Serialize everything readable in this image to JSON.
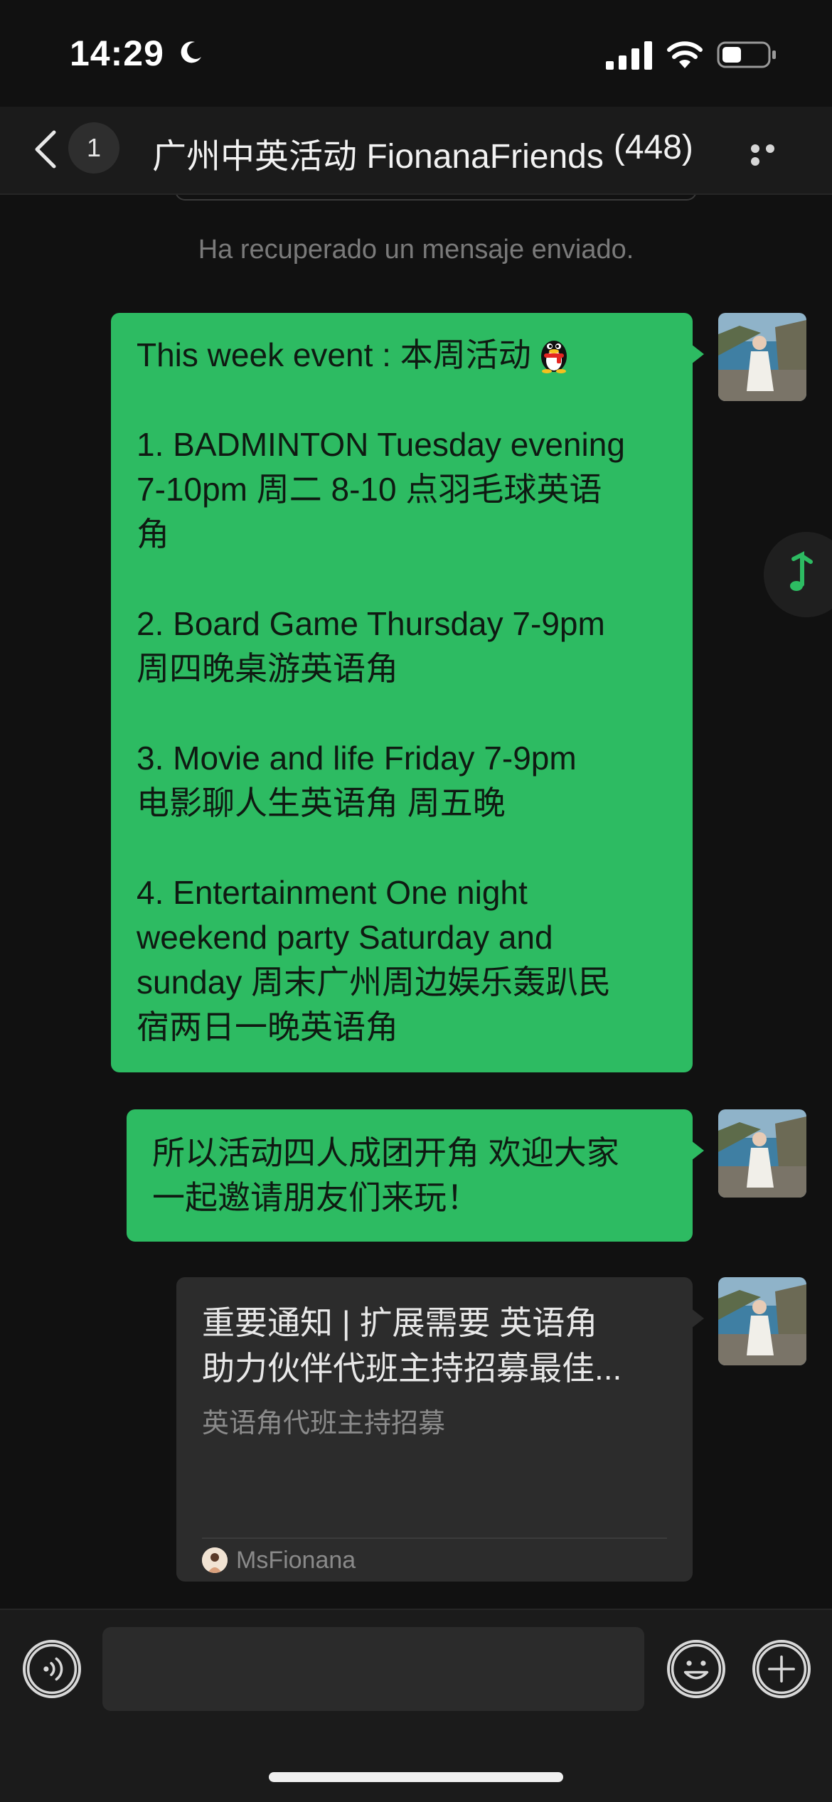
{
  "status_bar": {
    "time": "14:29"
  },
  "nav": {
    "unread_badge": "1",
    "title": "广州中英活动 FionanaFriends",
    "member_count": "(448)"
  },
  "system_message": "Ha recuperado un mensaje enviado.",
  "messages": [
    {
      "lines": [
        "This week event : 本周活动",
        "",
        "1. BADMINTON Tuesday evening",
        "7-10pm 周二 8-10 点羽毛球英语",
        "角",
        "",
        "2. Board Game Thursday 7-9pm",
        "周四晚桌游英语角",
        "",
        "3. Movie and life  Friday 7-9pm",
        "电影聊人生英语角 周五晚",
        "",
        "4. Entertainment One night",
        "weekend party Saturday and",
        "sunday  周末广州周边娱乐轰趴民",
        "宿两日一晚英语角"
      ]
    },
    {
      "lines": [
        "所以活动四人成团开角 欢迎大家",
        "一起邀请朋友们来玩！"
      ]
    }
  ],
  "card": {
    "title_line1": "重要通知 | 扩展需要 英语角",
    "title_line2": "助力伙伴代班主持招募最佳...",
    "description": "英语角代班主持招募",
    "source": "MsFionana"
  },
  "input": {
    "value": "",
    "placeholder": ""
  },
  "colors": {
    "bubble_green": "#2dbb62",
    "background": "#111111",
    "bar": "#1b1b1b",
    "card": "#2c2c2c"
  },
  "icons": [
    "moon-icon",
    "signal-icon",
    "wifi-icon",
    "battery-icon",
    "back-icon",
    "more-icon",
    "penguin-emoji-icon",
    "music-note-icon",
    "voice-icon",
    "emoji-icon",
    "plus-icon"
  ]
}
